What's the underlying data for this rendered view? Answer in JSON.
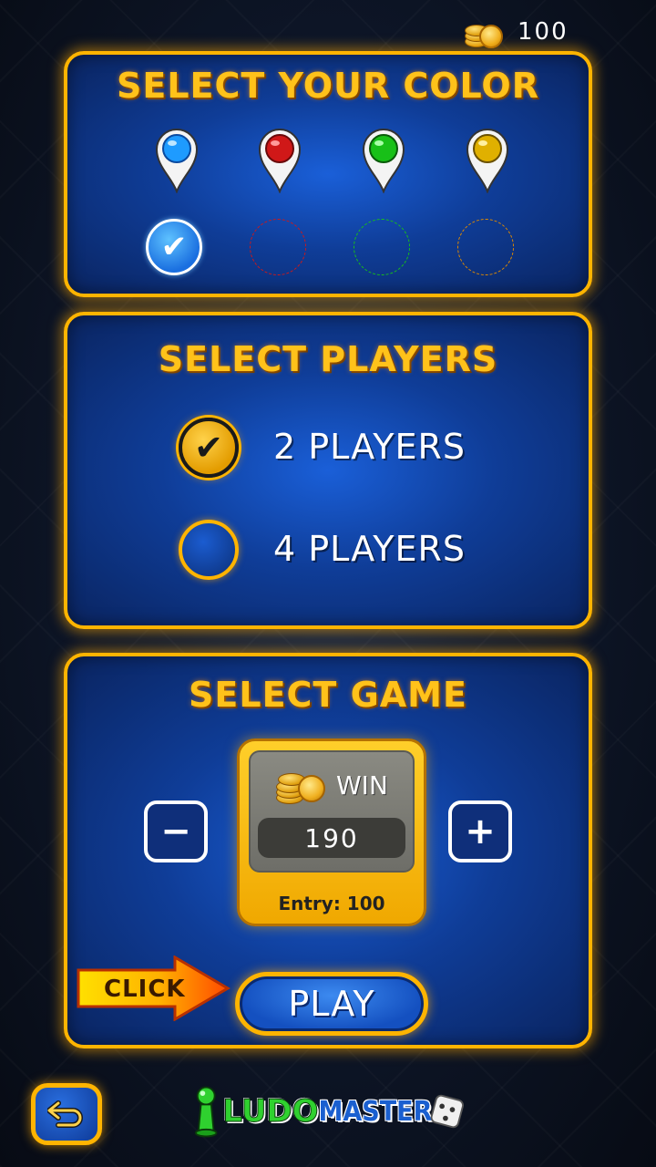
{
  "currency": {
    "coins": "100",
    "icon": "gold-coins-icon"
  },
  "color_panel": {
    "title": "SELECT YOUR COLOR",
    "colors": [
      {
        "name": "blue",
        "hex": "#1e9bff",
        "selected": true
      },
      {
        "name": "red",
        "hex": "#d01818",
        "selected": false
      },
      {
        "name": "green",
        "hex": "#18c018",
        "selected": false
      },
      {
        "name": "yellow",
        "hex": "#e0b000",
        "selected": false
      }
    ],
    "selected_mark": "✔"
  },
  "players_panel": {
    "title": "SELECT PLAYERS",
    "options": [
      {
        "label": "2 PLAYERS",
        "checked": true
      },
      {
        "label": "4 PLAYERS",
        "checked": false
      }
    ],
    "check_mark": "✔"
  },
  "game_panel": {
    "title": "SELECT GAME",
    "minus_label": "−",
    "plus_label": "+",
    "win_label": "WIN",
    "win_amount": "190",
    "entry_label": "Entry: 100",
    "click_label": "CLICK",
    "play_label": "PLAY"
  },
  "logo": {
    "ludo": "LUDO",
    "master": "MASTER"
  },
  "accent_color": "#ffb400"
}
